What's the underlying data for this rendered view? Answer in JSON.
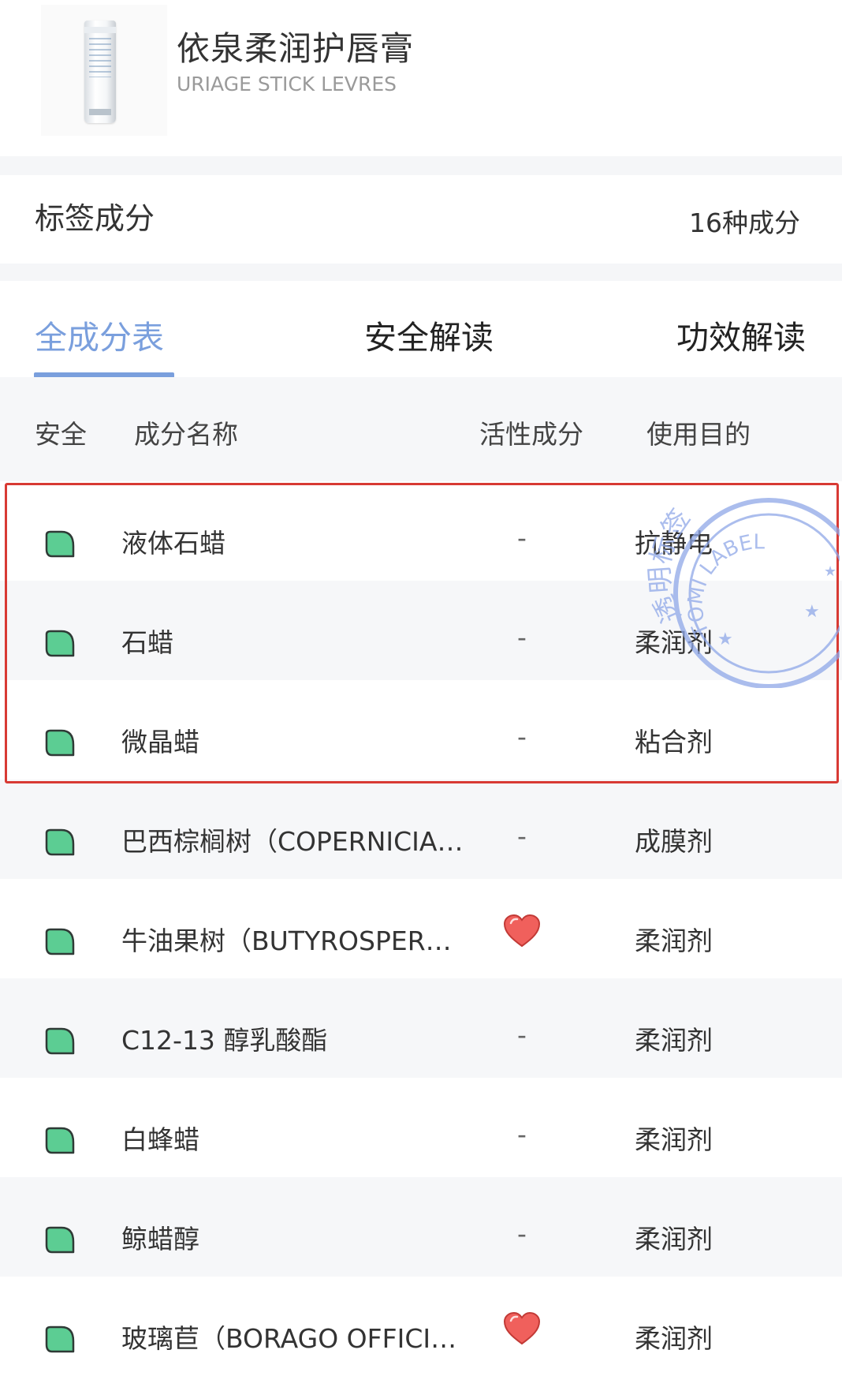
{
  "product": {
    "name": "依泉柔润护唇膏",
    "name_en": "URIAGE STICK LEVRES"
  },
  "label_section": {
    "title": "标签成分",
    "count": "16种成分"
  },
  "tabs": [
    {
      "label": "全成分表",
      "active": true
    },
    {
      "label": "安全解读",
      "active": false
    },
    {
      "label": "功效解读",
      "active": false
    }
  ],
  "columns": {
    "safety": "安全",
    "name": "成分名称",
    "active": "活性成分",
    "purpose": "使用目的"
  },
  "ingredients": [
    {
      "name": "液体石蜡",
      "active": "-",
      "purpose": "抗静电"
    },
    {
      "name": "石蜡",
      "active": "-",
      "purpose": "柔润剂"
    },
    {
      "name": "微晶蜡",
      "active": "-",
      "purpose": "粘合剂"
    },
    {
      "name": "巴西棕榈树（COPERNICIA…",
      "active": "-",
      "purpose": "成膜剂"
    },
    {
      "name": "牛油果树（BUTYROSPER…",
      "active": "heart",
      "purpose": "柔润剂"
    },
    {
      "name": "C12-13 醇乳酸酯",
      "active": "-",
      "purpose": "柔润剂"
    },
    {
      "name": "白蜂蜡",
      "active": "-",
      "purpose": "柔润剂"
    },
    {
      "name": "鲸蜡醇",
      "active": "-",
      "purpose": "柔润剂"
    },
    {
      "name": "玻璃苣（BORAGO OFFICI…",
      "active": "heart",
      "purpose": "柔润剂"
    }
  ],
  "watermark": {
    "text_cn": "透明标签",
    "text_en": "TOMI LABEL"
  },
  "colors": {
    "accent": "#7a9fdd",
    "leaf_fill": "#5ccd93",
    "heart": "#f0605c",
    "highlight_border": "#d83a34"
  }
}
